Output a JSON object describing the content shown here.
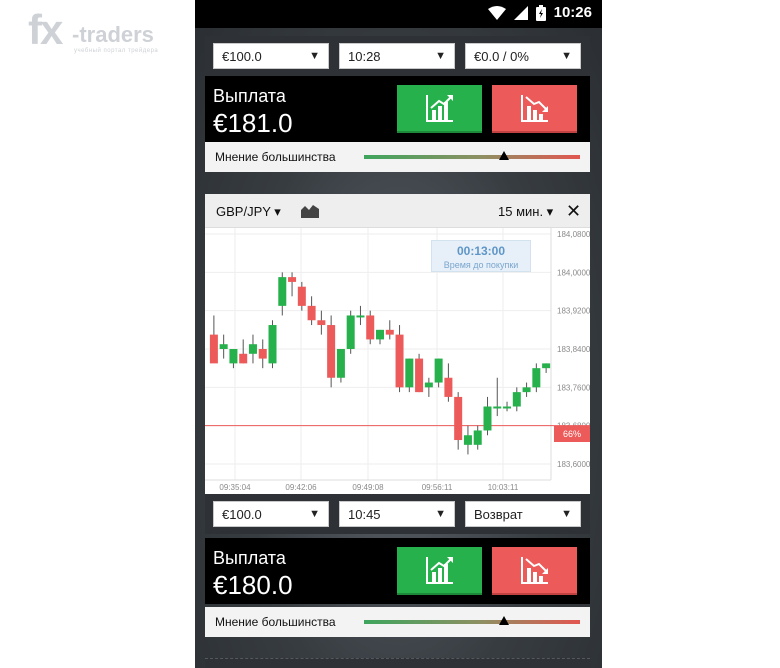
{
  "watermark": {
    "brand_fx": "fx",
    "brand_traders": "-traders",
    "tagline": "учебный портал трейдера"
  },
  "status_bar": {
    "time": "10:26"
  },
  "card1": {
    "amount": "€100.0",
    "expiry": "10:28",
    "refund": "€0.0 / 0%",
    "payout_label": "Выплата",
    "payout_value": "€181.0",
    "opinion_label": "Мнение большинства",
    "opinion_position": 0.65
  },
  "chart_card": {
    "pair": "GBP/JPY",
    "timeframe": "15 мин.",
    "timer_time": "00:13:00",
    "timer_label": "Время до покупки",
    "percent_label": "66%",
    "colors": {
      "up": "#27b14c",
      "down": "#ec5a5a",
      "line": "#ec5a5a"
    }
  },
  "chart_data": {
    "type": "candlestick",
    "y_ticks": [
      "184,0800",
      "184,0000",
      "183,9200",
      "183,8400",
      "183,7600",
      "183,6800",
      "183,6000"
    ],
    "ylim": [
      183.58,
      184.1
    ],
    "x_ticks": [
      "09:35:04",
      "09:42:06",
      "09:49:08",
      "09:56:11",
      "10:03:11"
    ],
    "strike_line": 183.68,
    "candles": [
      {
        "o": 183.87,
        "h": 183.91,
        "l": 183.83,
        "c": 183.81
      },
      {
        "o": 183.84,
        "h": 183.87,
        "l": 183.82,
        "c": 183.85
      },
      {
        "o": 183.81,
        "h": 183.84,
        "l": 183.8,
        "c": 183.84
      },
      {
        "o": 183.83,
        "h": 183.86,
        "l": 183.81,
        "c": 183.81
      },
      {
        "o": 183.83,
        "h": 183.87,
        "l": 183.81,
        "c": 183.85
      },
      {
        "o": 183.84,
        "h": 183.86,
        "l": 183.8,
        "c": 183.82
      },
      {
        "o": 183.81,
        "h": 183.9,
        "l": 183.8,
        "c": 183.89
      },
      {
        "o": 183.93,
        "h": 184.0,
        "l": 183.91,
        "c": 183.99
      },
      {
        "o": 183.99,
        "h": 184.0,
        "l": 183.95,
        "c": 183.98
      },
      {
        "o": 183.97,
        "h": 183.98,
        "l": 183.92,
        "c": 183.93
      },
      {
        "o": 183.93,
        "h": 183.95,
        "l": 183.89,
        "c": 183.9
      },
      {
        "o": 183.9,
        "h": 183.92,
        "l": 183.87,
        "c": 183.89
      },
      {
        "o": 183.89,
        "h": 183.91,
        "l": 183.76,
        "c": 183.78
      },
      {
        "o": 183.78,
        "h": 183.84,
        "l": 183.77,
        "c": 183.84
      },
      {
        "o": 183.84,
        "h": 183.92,
        "l": 183.83,
        "c": 183.91
      },
      {
        "o": 183.91,
        "h": 183.93,
        "l": 183.89,
        "c": 183.91
      },
      {
        "o": 183.91,
        "h": 183.92,
        "l": 183.85,
        "c": 183.86
      },
      {
        "o": 183.86,
        "h": 183.88,
        "l": 183.85,
        "c": 183.88
      },
      {
        "o": 183.88,
        "h": 183.9,
        "l": 183.86,
        "c": 183.87
      },
      {
        "o": 183.87,
        "h": 183.89,
        "l": 183.75,
        "c": 183.76
      },
      {
        "o": 183.76,
        "h": 183.82,
        "l": 183.75,
        "c": 183.82
      },
      {
        "o": 183.82,
        "h": 183.83,
        "l": 183.75,
        "c": 183.75
      },
      {
        "o": 183.76,
        "h": 183.78,
        "l": 183.74,
        "c": 183.77
      },
      {
        "o": 183.77,
        "h": 183.82,
        "l": 183.76,
        "c": 183.82
      },
      {
        "o": 183.78,
        "h": 183.81,
        "l": 183.73,
        "c": 183.74
      },
      {
        "o": 183.74,
        "h": 183.75,
        "l": 183.63,
        "c": 183.65
      },
      {
        "o": 183.64,
        "h": 183.68,
        "l": 183.62,
        "c": 183.66
      },
      {
        "o": 183.64,
        "h": 183.68,
        "l": 183.63,
        "c": 183.67
      },
      {
        "o": 183.67,
        "h": 183.74,
        "l": 183.66,
        "c": 183.72
      },
      {
        "o": 183.72,
        "h": 183.78,
        "l": 183.7,
        "c": 183.72
      },
      {
        "o": 183.72,
        "h": 183.73,
        "l": 183.71,
        "c": 183.72
      },
      {
        "o": 183.72,
        "h": 183.76,
        "l": 183.71,
        "c": 183.75
      },
      {
        "o": 183.75,
        "h": 183.77,
        "l": 183.74,
        "c": 183.76
      },
      {
        "o": 183.76,
        "h": 183.81,
        "l": 183.75,
        "c": 183.8
      },
      {
        "o": 183.8,
        "h": 183.81,
        "l": 183.79,
        "c": 183.81
      }
    ]
  },
  "card2": {
    "amount": "€100.0",
    "expiry": "10:45",
    "refund": "Возврат",
    "payout_label": "Выплата",
    "payout_value": "€180.0",
    "opinion_label": "Мнение большинства",
    "opinion_position": 0.65
  }
}
